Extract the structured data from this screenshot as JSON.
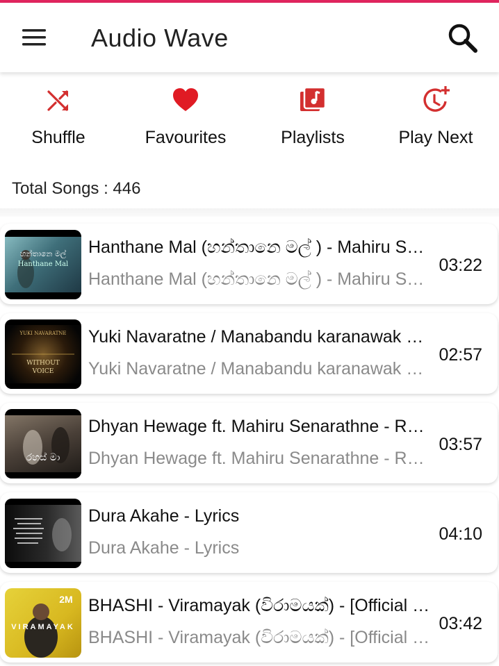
{
  "app": {
    "title": "Audio Wave",
    "accent_color": "#e0245e",
    "icon_color": "#d32f2f"
  },
  "actions": [
    {
      "label": "Shuffle",
      "icon": "shuffle-icon"
    },
    {
      "label": "Favourites",
      "icon": "heart-icon"
    },
    {
      "label": "Playlists",
      "icon": "playlist-icon"
    },
    {
      "label": "Play Next",
      "icon": "clock-plus-icon"
    }
  ],
  "summary": {
    "total_label": "Total Songs : 446"
  },
  "songs": [
    {
      "title": "Hanthane Mal (හන්තානෙ මල් )  - Mahiru Senarathne",
      "subtitle": "Hanthane Mal (හන්තානෙ මල් )  - Mahiru Senarathne",
      "duration": "03:22",
      "thumb_text": "හන්තානෙ මල්",
      "thumb_sub": "Hanthane Mal"
    },
    {
      "title": "Yuki Navaratne / Manabandu karanawak Without Voice",
      "subtitle": "Yuki Navaratne / Manabandu karanawak Without Voice",
      "duration": "02:57",
      "thumb_text": "WITHOUT VOICE",
      "thumb_sub": "YUKI NAVARATNE"
    },
    {
      "title": "Dhyan Hewage ft. Mahiru Senarathne - Rahas Ma",
      "subtitle": "Dhyan Hewage ft. Mahiru Senarathne - Rahas Ma",
      "duration": "03:57",
      "thumb_text": "රහස් මා",
      "thumb_sub": ""
    },
    {
      "title": "Dura Akahe - Lyrics",
      "subtitle": "Dura Akahe - Lyrics",
      "duration": "04:10",
      "thumb_text": "",
      "thumb_sub": ""
    },
    {
      "title": "BHASHI - Viramayak (විරාමයක්) - [Official Music Video]",
      "subtitle": "BHASHI - Viramayak (විරාමයක්) - [Official Music Video]",
      "duration": "03:42",
      "thumb_text": "VIRAMAYAK",
      "thumb_sub": "2M"
    }
  ]
}
